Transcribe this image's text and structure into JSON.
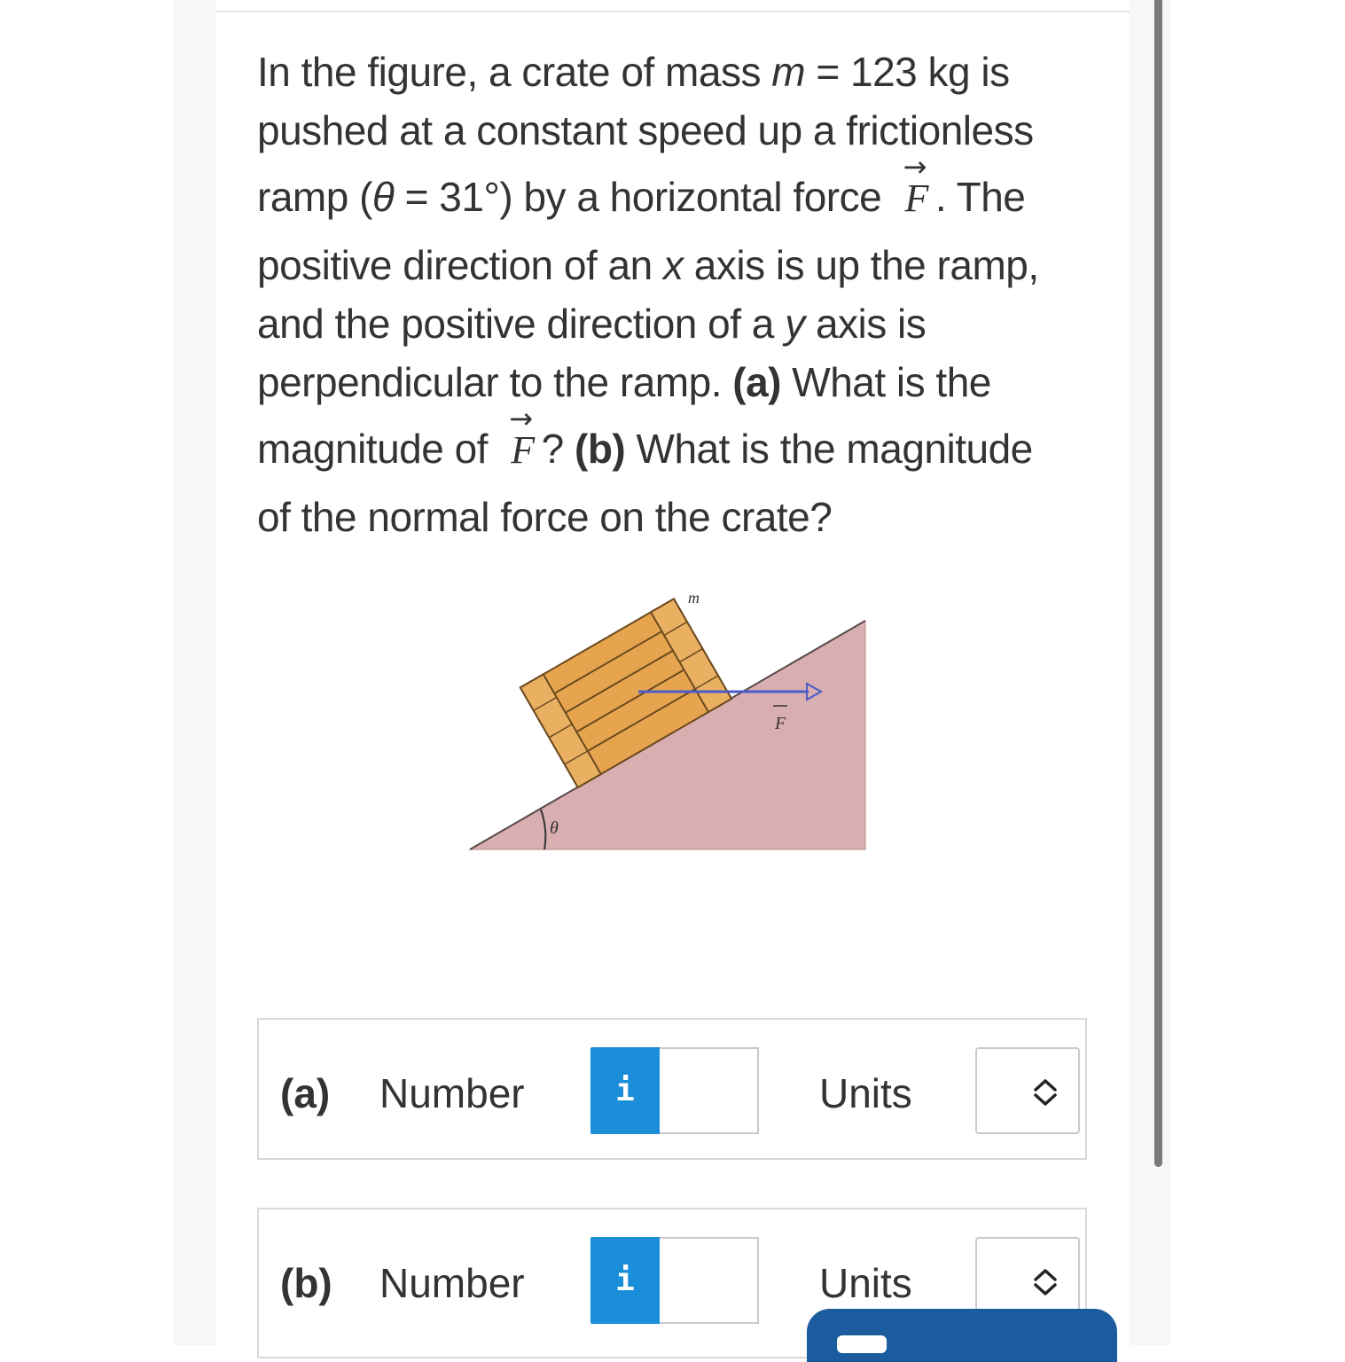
{
  "question": {
    "line1": [
      "In the figure, a crate of mass ",
      "m",
      " = 123 kg is"
    ],
    "line2": "pushed at a constant speed up a frictionless",
    "line3": [
      "ramp (",
      "θ",
      " = 31°) by a horizontal force ",
      "F",
      ". The"
    ],
    "line4": [
      "positive direction of an ",
      "x",
      " axis is up the ramp,"
    ],
    "line5": [
      "and the positive direction of a ",
      "y",
      " axis is"
    ],
    "line6": [
      "perpendicular to the ramp. ",
      "(a)",
      " What is the"
    ],
    "line7": [
      "magnitude of ",
      "F",
      "? ",
      "(b)",
      " What is the magnitude"
    ],
    "line8": "of the normal force on the crate?",
    "vector_arrow": "→"
  },
  "figure": {
    "mass_label": "m",
    "force_label": "F",
    "angle_label": "θ",
    "ramp_color": "#d8aeb1",
    "crate_color": "#e6a44f",
    "force_arrow_color": "#4a5cc8"
  },
  "answers": [
    {
      "part": "(a)",
      "number_label": "Number",
      "info_glyph": "i",
      "value": "",
      "units_label": "Units"
    },
    {
      "part": "(b)",
      "number_label": "Number",
      "info_glyph": "i",
      "value": "",
      "units_label": "Units"
    }
  ],
  "colors": {
    "info_button": "#1a8ed8",
    "bottom_button": "#1b5c9e"
  }
}
